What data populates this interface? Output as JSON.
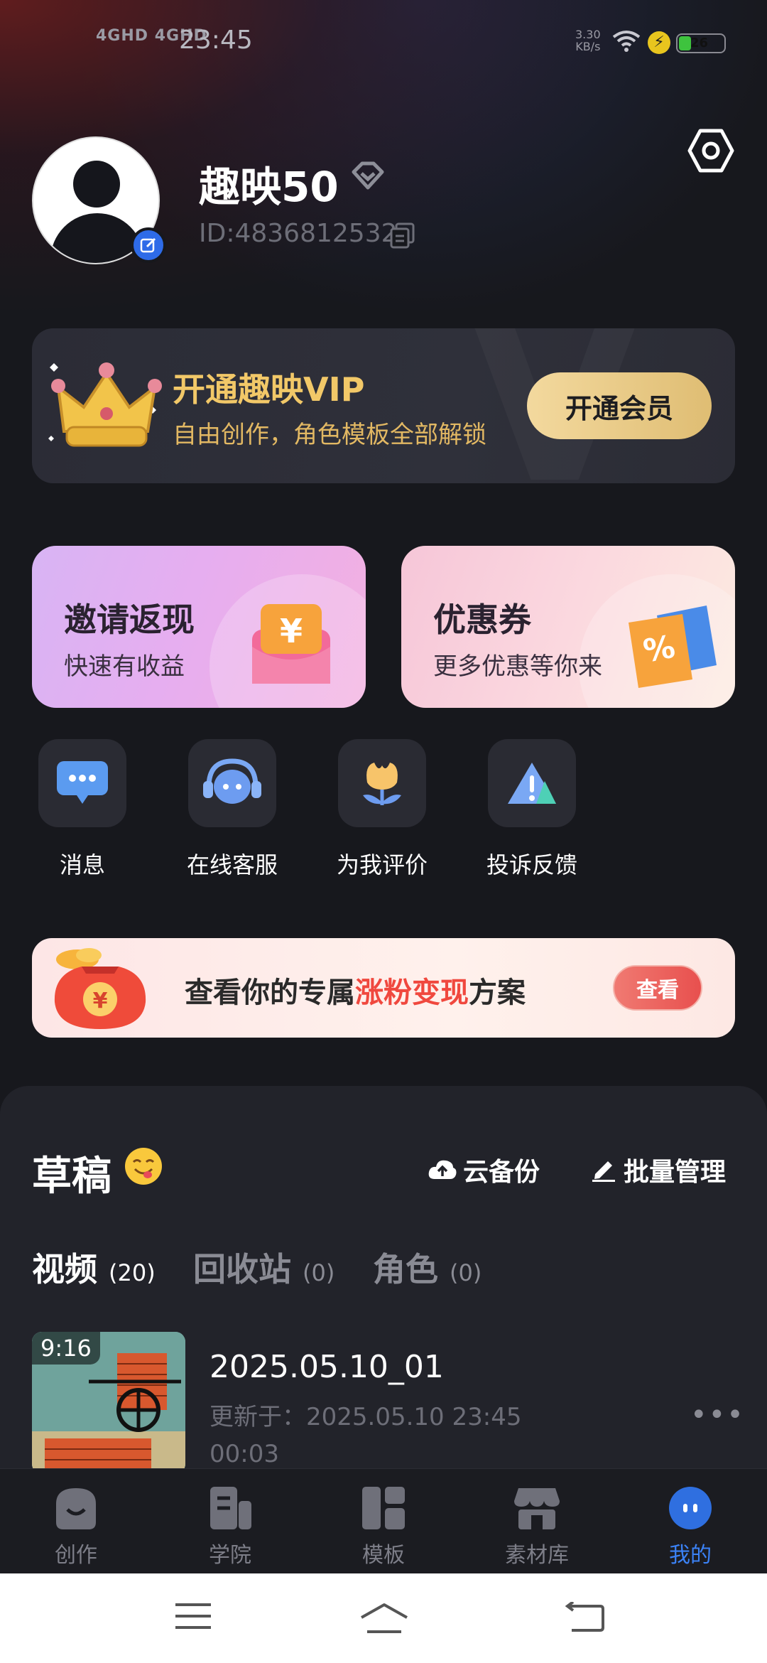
{
  "status_bar": {
    "network": "4GHD 4GHD",
    "time": "23:45",
    "speed_value": "3.30",
    "speed_unit": "KB/s",
    "battery": "26"
  },
  "profile": {
    "username": "趣映50",
    "user_id": "ID:4836812532"
  },
  "vip": {
    "title": "开通趣映VIP",
    "subtitle": "自由创作，角色模板全部解锁",
    "button": "开通会员"
  },
  "promos": {
    "invite_title": "邀请返现",
    "invite_sub": "快速有收益",
    "coupon_title": "优惠券",
    "coupon_sub": "更多优惠等你来"
  },
  "quick_actions": {
    "messages": "消息",
    "support": "在线客服",
    "rate": "为我评价",
    "feedback": "投诉反馈"
  },
  "banner": {
    "text_a": "查看你的专属",
    "text_highlight": "涨粉变现",
    "text_b": "方案",
    "button": "查看"
  },
  "drafts": {
    "title": "草稿",
    "cloud_backup": "云备份",
    "batch_manage": "批量管理",
    "tabs": [
      {
        "label": "视频",
        "count": "(20)"
      },
      {
        "label": "回收站",
        "count": "(0)"
      },
      {
        "label": "角色",
        "count": "(0)"
      }
    ],
    "items": [
      {
        "thumb_time": "9:16",
        "title": "2025.05.10_01",
        "updated": "更新于：2025.05.10  23:45",
        "duration": "00:03",
        "more": "•••"
      }
    ]
  },
  "bottom_nav": [
    {
      "label": "创作"
    },
    {
      "label": "学院"
    },
    {
      "label": "模板"
    },
    {
      "label": "素材库"
    },
    {
      "label": "我的"
    }
  ],
  "colors": {
    "background": "#17181d",
    "accent": "#3b82f6",
    "vip_gold": "#f2c868",
    "highlight_red": "#f0483e"
  }
}
